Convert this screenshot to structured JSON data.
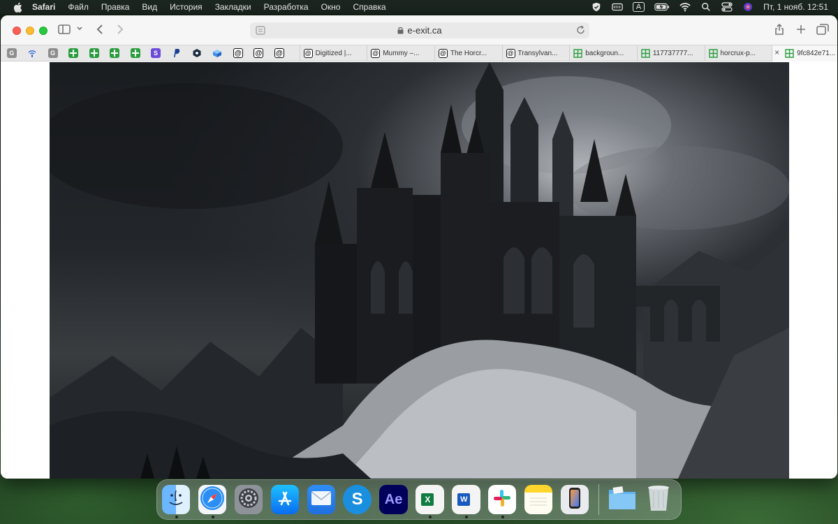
{
  "menubar": {
    "app_name": "Safari",
    "menus": [
      "Файл",
      "Правка",
      "Вид",
      "История",
      "Закладки",
      "Разработка",
      "Окно",
      "Справка"
    ],
    "keyboard_layout": "A",
    "clock": "Пт, 1 нояб.  12:51",
    "status_icons": [
      "vpn-shield-icon",
      "menu-extra-icon",
      "input-source-icon",
      "battery-icon",
      "wifi-icon",
      "spotlight-search-icon",
      "control-center-icon",
      "siri-icon"
    ]
  },
  "toolbar": {
    "address": "e-exit.ca"
  },
  "tabs": {
    "pinned": [
      {
        "icon": "g-icon",
        "letter": "G"
      },
      {
        "icon": "wifi-like-icon",
        "letter": ""
      },
      {
        "icon": "g-icon",
        "letter": "G"
      },
      {
        "icon": "sheets-icon",
        "letter": ""
      },
      {
        "icon": "sheets-icon",
        "letter": ""
      },
      {
        "icon": "sheets-icon",
        "letter": ""
      },
      {
        "icon": "sheets-icon",
        "letter": ""
      },
      {
        "icon": "s-icon",
        "letter": "S"
      },
      {
        "icon": "paypal-icon",
        "letter": ""
      },
      {
        "icon": "hex-icon",
        "letter": ""
      },
      {
        "icon": "cube-icon",
        "letter": ""
      },
      {
        "icon": "at-icon",
        "letter": ""
      },
      {
        "icon": "at-icon",
        "letter": ""
      },
      {
        "icon": "at-icon",
        "letter": ""
      }
    ],
    "open": [
      {
        "label": "Digitized |...",
        "icon": "at-icon"
      },
      {
        "label": "Mummy –...",
        "icon": "at-icon"
      },
      {
        "label": "The Horcr...",
        "icon": "at-icon"
      },
      {
        "label": "Transylvan...",
        "icon": "at-icon"
      },
      {
        "label": "backgroun...",
        "icon": "sheets-icon"
      },
      {
        "label": "117737777...",
        "icon": "sheets-icon"
      },
      {
        "label": "horcrux-p...",
        "icon": "sheets-icon"
      },
      {
        "label": "9fc842e71...",
        "icon": "sheets-icon",
        "active": true
      }
    ]
  },
  "dock": {
    "apps": [
      {
        "name": "Finder",
        "icon": "finder-icon",
        "running": true
      },
      {
        "name": "Safari",
        "icon": "safari-icon",
        "running": true
      },
      {
        "name": "System Settings",
        "icon": "settings-icon",
        "running": false
      },
      {
        "name": "App Store",
        "icon": "app-store-icon",
        "running": false
      },
      {
        "name": "Mail",
        "icon": "mail-icon",
        "running": false
      },
      {
        "name": "Skype",
        "icon": "skype-icon",
        "label": "S",
        "running": false
      },
      {
        "name": "After Effects",
        "icon": "after-effects-icon",
        "label": "Ae",
        "running": false
      },
      {
        "name": "Excel",
        "icon": "excel-icon",
        "label": "X",
        "running": true
      },
      {
        "name": "Word",
        "icon": "word-icon",
        "label": "W",
        "running": true
      },
      {
        "name": "Slack",
        "icon": "slack-icon",
        "running": true
      },
      {
        "name": "Notes",
        "icon": "notes-icon",
        "running": false
      },
      {
        "name": "iPhone Mirroring",
        "icon": "iphone-mirroring-icon",
        "running": false
      },
      {
        "name": "Downloads",
        "icon": "folder-icon",
        "running": false
      },
      {
        "name": "Trash",
        "icon": "trash-icon",
        "running": false
      }
    ]
  },
  "colors": {
    "menubar_bg": "#1e2822",
    "window_bg": "#ffffff",
    "tab_bg": "#e8e8e8",
    "hero_sky": "#2c3035"
  }
}
